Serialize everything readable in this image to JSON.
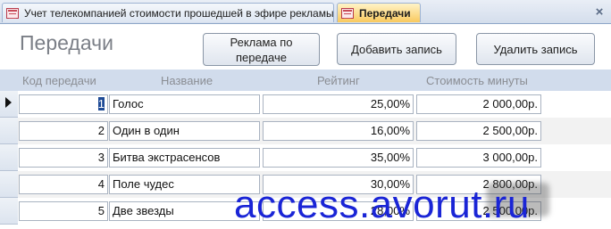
{
  "tabs": [
    {
      "label": "Учет телекомпанией стоимости прошедшей в эфире рекламы",
      "active": false,
      "icon": "form-icon"
    },
    {
      "label": "Передачи",
      "active": true,
      "icon": "form-icon"
    }
  ],
  "close_label": "×",
  "form": {
    "title": "Передачи",
    "buttons": {
      "ads": "Реклама по передаче",
      "add": "Добавить запись",
      "delete": "Удалить запись"
    },
    "columns": {
      "code": "Код передачи",
      "name": "Название",
      "rating": "Рейтинг",
      "cost": "Стоимость минуты"
    }
  },
  "records": [
    {
      "code": "1",
      "name": "Голос",
      "rating": "25,00%",
      "cost": "2 000,00р."
    },
    {
      "code": "2",
      "name": "Один в один",
      "rating": "16,00%",
      "cost": "2 500,00р."
    },
    {
      "code": "3",
      "name": "Битва экстрасенсов",
      "rating": "35,00%",
      "cost": "3 000,00р."
    },
    {
      "code": "4",
      "name": "Поле чудес",
      "rating": "30,00%",
      "cost": "2 800,00р."
    },
    {
      "code": "5",
      "name": "Две звезды",
      "rating": "28,00%",
      "cost": "2 500,00р."
    }
  ],
  "watermark": "access.avorut.ru",
  "colors": {
    "active_tab": "#f9c95e",
    "header_strip": "#d1dcec",
    "watermark": "#1a25d6"
  }
}
